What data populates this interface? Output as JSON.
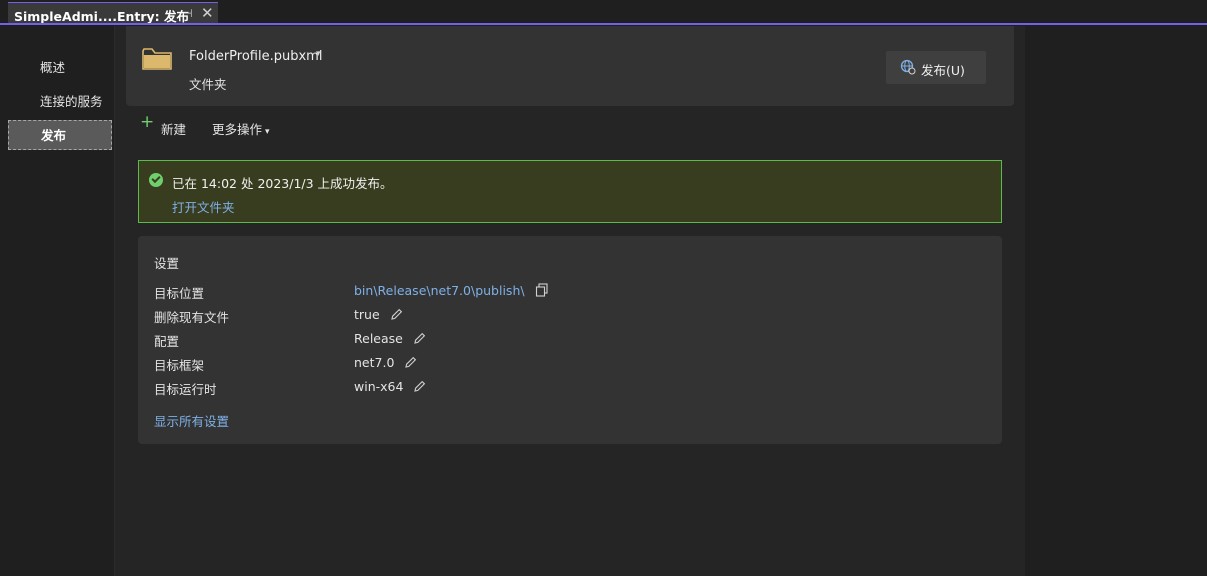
{
  "tab": {
    "title": "SimpleAdmi....Entry: 发布",
    "pin_glyph": "⊣",
    "close_glyph": "✕"
  },
  "sidebar": {
    "items": [
      {
        "label": "概述",
        "active": false
      },
      {
        "label": "连接的服务",
        "active": false
      },
      {
        "label": "发布",
        "active": true
      }
    ]
  },
  "profile": {
    "name": "FolderProfile.pubxml",
    "caret": "▾",
    "type": "文件夹",
    "folder_icon": "folder-icon",
    "publish_button": "发布(U)"
  },
  "actions": {
    "new_icon": "+",
    "new_label": "新建",
    "more_label": "更多操作",
    "more_caret": "▾"
  },
  "banner": {
    "message": "已在 14:02 处 2023/1/3 上成功发布。",
    "link": "打开文件夹"
  },
  "settings": {
    "title": "设置",
    "rows": [
      {
        "key": "目标位置",
        "value": "bin\\Release\\net7.0\\publish\\"
      },
      {
        "key": "删除现有文件",
        "value": "true"
      },
      {
        "key": "配置",
        "value": "Release"
      },
      {
        "key": "目标框架",
        "value": "net7.0"
      },
      {
        "key": "目标运行时",
        "value": "win-x64"
      }
    ],
    "show_all": "显示所有设置"
  },
  "colors": {
    "accent": "#7160e8",
    "success_border": "#5bbb4a",
    "success_bg": "#393d1f",
    "link": "#7fb0e6",
    "folder": "#dcb86c"
  }
}
